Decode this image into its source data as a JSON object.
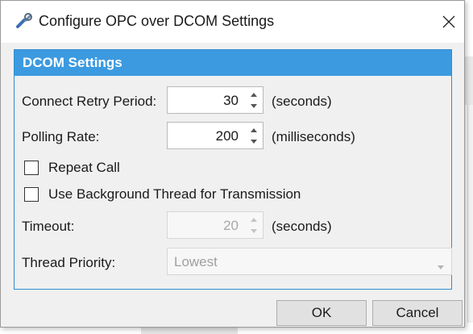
{
  "window": {
    "title": "Configure OPC over DCOM Settings",
    "icon": "wrench-icon"
  },
  "group": {
    "header": "DCOM Settings",
    "accent_color": "#3c9ae0"
  },
  "fields": {
    "connect_retry": {
      "label": "Connect Retry Period:",
      "value": "30",
      "unit": "(seconds)"
    },
    "polling_rate": {
      "label": "Polling Rate:",
      "value": "200",
      "unit": "(milliseconds)"
    },
    "repeat_call": {
      "label": "Repeat Call",
      "checked": false
    },
    "background_thread": {
      "label": "Use Background Thread for Transmission",
      "checked": false
    },
    "timeout": {
      "label": "Timeout:",
      "value": "20",
      "unit": "(seconds)",
      "enabled": false
    },
    "thread_priority": {
      "label": "Thread Priority:",
      "value": "Lowest",
      "enabled": false
    }
  },
  "buttons": {
    "ok": "OK",
    "cancel": "Cancel"
  }
}
